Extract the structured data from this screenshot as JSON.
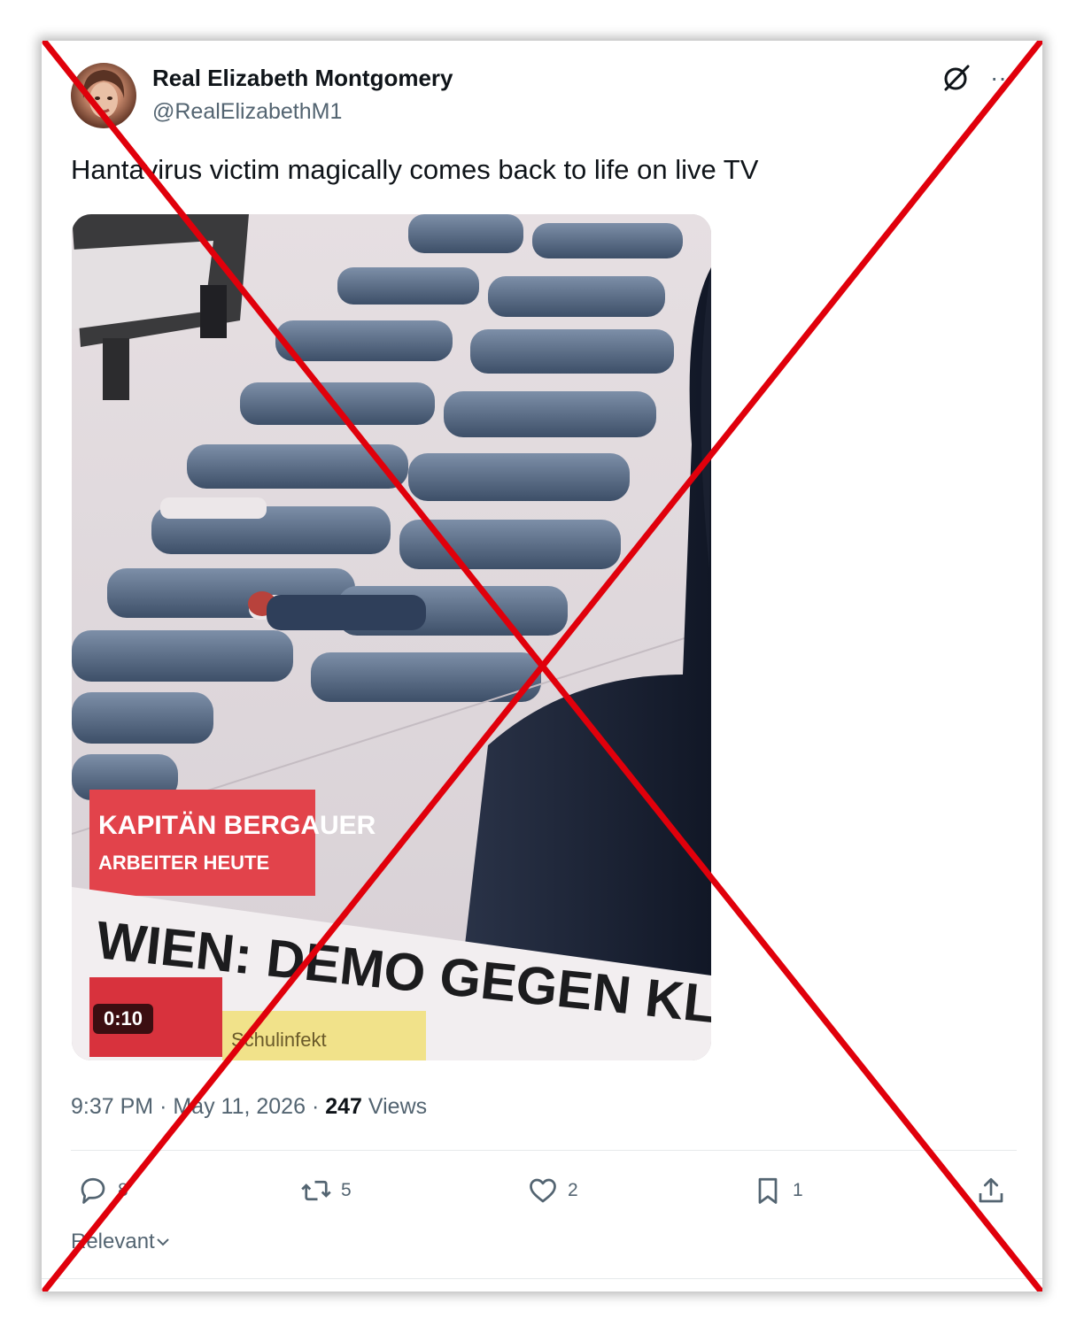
{
  "post": {
    "display_name": "Real Elizabeth Montgomery",
    "handle": "@RealElizabethM1",
    "text": "Hantavirus victim magically comes back to life on live TV",
    "media": {
      "duration": "0:10",
      "overlay_tag_top": "KAPITÄN BERGAUER",
      "overlay_tag_sub": "ARBEITER HEUTE",
      "overlay_headline": "WIEN: DEMO GEGEN KLIMA",
      "overlay_ticker": "Schulinfekt"
    },
    "time": "9:37 PM",
    "date": "May 11, 2026",
    "separator": "·",
    "views_count": "247",
    "views_label": "Views"
  },
  "actions": {
    "reply_count": "8",
    "repost_count": "5",
    "like_count": "2",
    "bookmark_count": "1"
  },
  "replies": {
    "sort_label": "Relevant"
  },
  "colors": {
    "text_primary": "#0f1419",
    "text_secondary": "#536471",
    "cross_mark": "#e0000b"
  },
  "icons": [
    "grok-icon",
    "more-icon",
    "reply-icon",
    "repost-icon",
    "like-icon",
    "bookmark-icon",
    "share-icon",
    "chevron-down-icon"
  ]
}
